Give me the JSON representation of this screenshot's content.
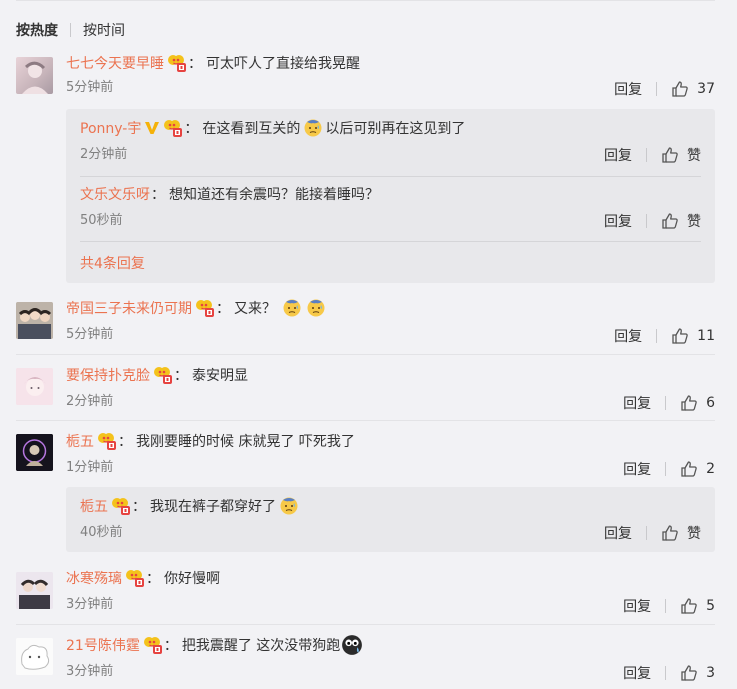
{
  "sort": {
    "hot": "按热度",
    "time": "按时间"
  },
  "labels": {
    "reply": "回复",
    "like": "赞"
  },
  "comments": [
    {
      "user": "七七今天要早睡",
      "colon": "：",
      "text": "可太吓人了直接给我晃醒",
      "time": "5分钟前",
      "likes": "37",
      "replies": [
        {
          "user": "Ponny-宇",
          "colon": "：",
          "text": "在这看到互关的",
          "text2": "以后可别再在这见到了",
          "time": "2分钟前"
        },
        {
          "user": "文乐文乐呀",
          "colon": "：",
          "text": "想知道还有余震吗？能接着睡吗？",
          "time": "50秒前"
        }
      ],
      "more": "共4条回复"
    },
    {
      "user": "帝国三子未来仍可期",
      "colon": "：",
      "text": "又来？",
      "time": "5分钟前",
      "likes": "11"
    },
    {
      "user": "要保持扑克脸",
      "colon": "：",
      "text": "泰安明显",
      "time": "2分钟前",
      "likes": "6"
    },
    {
      "user": "栀五",
      "colon": "：",
      "text": "我刚要睡的时候 床就晃了 吓死我了",
      "time": "1分钟前",
      "likes": "2",
      "replies": [
        {
          "user": "栀五",
          "colon": "：",
          "text": "我现在裤子都穿好了",
          "time": "40秒前"
        }
      ]
    },
    {
      "user": "冰寒殇璃",
      "colon": "：",
      "text": "你好慢啊",
      "time": "3分钟前",
      "likes": "5"
    },
    {
      "user": "21号陈伟霆",
      "colon": "：",
      "text": "把我震醒了 这次没带狗跑",
      "time": "3分钟前",
      "likes": "3"
    }
  ],
  "colors": {
    "accent": "#eb7350",
    "background": "#f2f2f5",
    "subbox": "#e8e8eb",
    "muted": "#808080"
  },
  "icons": [
    "member-badge-icon",
    "verified-v-icon",
    "thumbs-up-icon",
    "sweat-emoji-icon",
    "doge-emoji-icon"
  ]
}
